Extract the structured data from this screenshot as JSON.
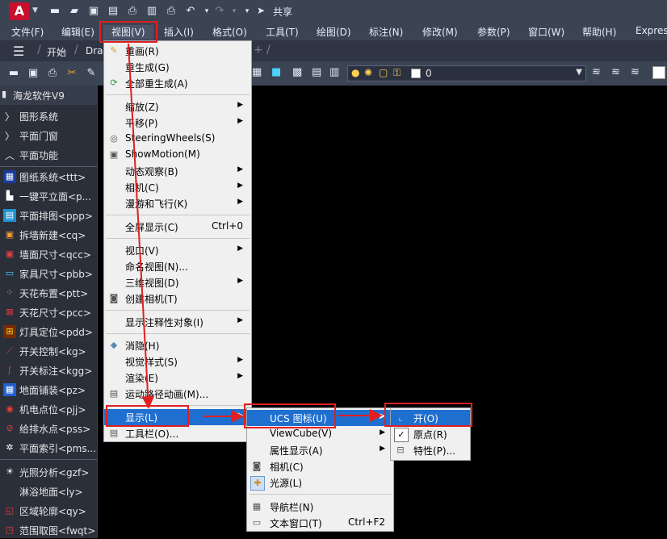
{
  "qat": {
    "logo_letter": "A",
    "share_label": "共享"
  },
  "menubar": [
    {
      "label": "文件(F)"
    },
    {
      "label": "编辑(E)"
    },
    {
      "label": "视图(V)"
    },
    {
      "label": "插入(I)"
    },
    {
      "label": "格式(O)"
    },
    {
      "label": "工具(T)"
    },
    {
      "label": "绘图(D)"
    },
    {
      "label": "标注(N)"
    },
    {
      "label": "修改(M)"
    },
    {
      "label": "参数(P)"
    },
    {
      "label": "窗口(W)"
    },
    {
      "label": "帮助(H)"
    },
    {
      "label": "Expres"
    }
  ],
  "tabs": {
    "start": "开始",
    "drawing": "Dra"
  },
  "layer": {
    "current": "0"
  },
  "sidebar": {
    "title": "海龙软件V9",
    "groups": [
      {
        "label": "图形系统"
      },
      {
        "label": "平面门窗"
      },
      {
        "label": "平面功能"
      }
    ],
    "items": [
      {
        "label": "图纸系统<ttt>",
        "icon": "drawing-system-icon"
      },
      {
        "label": "一键平立面<p...",
        "icon": "elevation-icon"
      },
      {
        "label": "平面排图<ppp>",
        "icon": "layout-icon"
      },
      {
        "label": "拆墙新建<cq>",
        "icon": "wall-icon"
      },
      {
        "label": "墙面尺寸<qcc>",
        "icon": "wall-dim-icon"
      },
      {
        "label": "家具尺寸<pbb>",
        "icon": "furniture-icon"
      },
      {
        "label": "天花布置<ptt>",
        "icon": "ceiling-icon"
      },
      {
        "label": "天花尺寸<pcc>",
        "icon": "ceiling-dim-icon"
      },
      {
        "label": "灯具定位<pdd>",
        "icon": "lamp-icon"
      },
      {
        "label": "开关控制<kg>",
        "icon": "switch-icon"
      },
      {
        "label": "开关标注<kgg>",
        "icon": "switch-label-icon"
      },
      {
        "label": "地面铺装<pz>",
        "icon": "floor-icon"
      },
      {
        "label": "机电点位<pjj>",
        "icon": "electric-icon"
      },
      {
        "label": "给排水点<pss>",
        "icon": "water-icon"
      },
      {
        "label": "平面索引<pms...",
        "icon": "index-icon"
      },
      {
        "label": "光照分析<gzf>",
        "icon": "light-icon"
      },
      {
        "label": "淋浴地面<ly>",
        "icon": "shower-icon"
      },
      {
        "label": "区域轮廓<qy>",
        "icon": "outline-icon"
      },
      {
        "label": "范围取图<fwqt>",
        "icon": "crop-icon"
      }
    ]
  },
  "view_menu": {
    "items": [
      {
        "label": "重画(R)",
        "icon": "redraw-icon"
      },
      {
        "label": "重生成(G)"
      },
      {
        "label": "全部重生成(A)",
        "icon": "regen-all-icon"
      },
      {
        "label": "缩放(Z)",
        "submenu": true
      },
      {
        "label": "平移(P)",
        "submenu": true
      },
      {
        "label": "SteeringWheels(S)",
        "icon": "steering-wheel-icon"
      },
      {
        "label": "ShowMotion(M)",
        "icon": "showmotion-icon"
      },
      {
        "label": "动态观察(B)",
        "submenu": true
      },
      {
        "label": "相机(C)",
        "submenu": true
      },
      {
        "label": "漫游和飞行(K)",
        "submenu": true
      },
      {
        "label": "全屏显示(C)",
        "shortcut": "Ctrl+0"
      },
      {
        "label": "视口(V)",
        "submenu": true
      },
      {
        "label": "命名视图(N)..."
      },
      {
        "label": "三维视图(D)",
        "submenu": true
      },
      {
        "label": "创建相机(T)",
        "icon": "camera-create-icon"
      },
      {
        "label": "显示注释性对象(I)",
        "submenu": true
      },
      {
        "label": "消隐(H)",
        "icon": "hide-icon"
      },
      {
        "label": "视觉样式(S)",
        "submenu": true
      },
      {
        "label": "渲染(E)",
        "submenu": true
      },
      {
        "label": "运动路径动画(M)...",
        "icon": "motion-path-icon"
      },
      {
        "label": "显示(L)",
        "submenu": true
      },
      {
        "label": "工具栏(O)...",
        "icon": "toolbar-icon"
      }
    ]
  },
  "display_menu": {
    "items": [
      {
        "label": "UCS 图标(U)",
        "submenu": true
      },
      {
        "label": "ViewCube(V)",
        "submenu": true
      },
      {
        "label": "属性显示(A)",
        "submenu": true
      },
      {
        "label": "相机(C)",
        "icon": "camera-icon"
      },
      {
        "label": "光源(L)",
        "icon": "light-source-icon"
      },
      {
        "label": "导航栏(N)",
        "icon": "navbar-icon"
      },
      {
        "label": "文本窗口(T)",
        "shortcut": "Ctrl+F2",
        "icon": "text-window-icon"
      }
    ]
  },
  "ucs_menu": {
    "items": [
      {
        "label": "开(O)"
      },
      {
        "label": "原点(R)",
        "checked": true
      },
      {
        "label": "特性(P)..."
      }
    ]
  },
  "colors": {
    "accent": "#1f6fd0",
    "annotation": "#e02020",
    "logo": "#c8102e"
  }
}
